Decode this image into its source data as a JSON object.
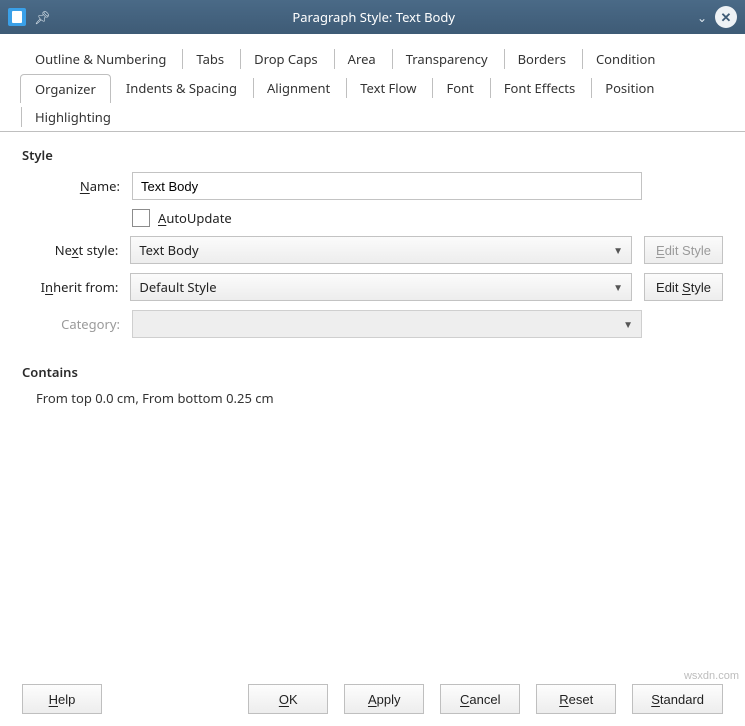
{
  "title": "Paragraph Style: Text Body",
  "tabs_top": [
    "Outline & Numbering",
    "Tabs",
    "Drop Caps",
    "Area",
    "Transparency",
    "Borders",
    "Condition"
  ],
  "tabs_bottom": [
    "Organizer",
    "Indents & Spacing",
    "Alignment",
    "Text Flow",
    "Font",
    "Font Effects",
    "Position",
    "Highlighting"
  ],
  "active_tab": "Organizer",
  "sections": {
    "style_title": "Style",
    "contains_title": "Contains",
    "contains_text": "From top 0.0 cm, From bottom 0.25 cm"
  },
  "labels": {
    "name_pre": "",
    "name_u": "N",
    "name_post": "ame:",
    "autoupdate_pre": "",
    "autoupdate_u": "A",
    "autoupdate_post": "utoUpdate",
    "next_pre": "Ne",
    "next_u": "x",
    "next_post": "t style:",
    "inherit_pre": "I",
    "inherit_u": "n",
    "inherit_post": "herit from:",
    "category": "Category:",
    "edit1_pre": "",
    "edit1_u": "E",
    "edit1_post": "dit Style",
    "edit2_pre": "Edit ",
    "edit2_u": "S",
    "edit2_post": "tyle"
  },
  "values": {
    "name": "Text Body",
    "next_style": "Text Body",
    "inherit_from": "Default Style",
    "category": ""
  },
  "footer": {
    "help_pre": "",
    "help_u": "H",
    "help_post": "elp",
    "ok_pre": "",
    "ok_u": "O",
    "ok_post": "K",
    "apply_pre": "",
    "apply_u": "A",
    "apply_post": "pply",
    "cancel_pre": "",
    "cancel_u": "C",
    "cancel_post": "ancel",
    "reset_pre": "",
    "reset_u": "R",
    "reset_post": "eset",
    "standard_pre": "",
    "standard_u": "S",
    "standard_post": "tandard"
  },
  "watermark": "wsxdn.com"
}
